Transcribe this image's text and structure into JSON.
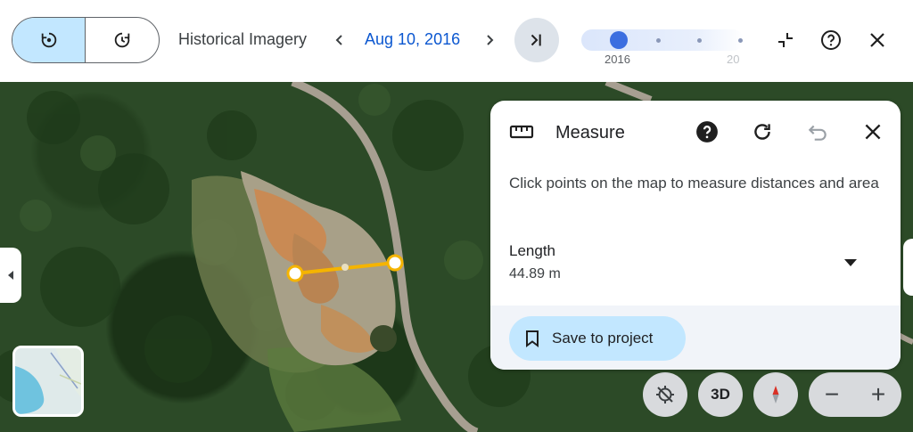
{
  "toolbar": {
    "title": "Historical Imagery",
    "date": "Aug 10, 2016",
    "timeline": {
      "labels": [
        "2016",
        "20"
      ],
      "selected_year": "2016",
      "accent": "#3b6ee0"
    },
    "icons": {
      "history_mode": "history-reverse-icon",
      "latest_mode": "history-forward-icon",
      "prev": "chevron-left-icon",
      "next": "chevron-right-icon",
      "skip_latest": "skip-to-end-icon",
      "collapse": "collapse-icon",
      "help": "help-icon",
      "close": "close-icon"
    }
  },
  "measure": {
    "title": "Measure",
    "description": "Click points on the map to measure distances and area",
    "length_label": "Length",
    "length_value": "44.89 m",
    "save_label": "Save to project",
    "icons": [
      "ruler-icon",
      "help-icon",
      "reset-icon",
      "undo-icon",
      "close-icon",
      "dropdown-icon",
      "bookmark-icon"
    ]
  },
  "map_controls": {
    "view_3d_label": "3D",
    "zoom_out": "−",
    "zoom_in": "+",
    "icons": [
      "location-off-icon",
      "compass-icon"
    ]
  },
  "colors": {
    "active_segment": "#c2e7ff",
    "link_blue": "#0b57d0",
    "measure_line": "#f5b400"
  }
}
